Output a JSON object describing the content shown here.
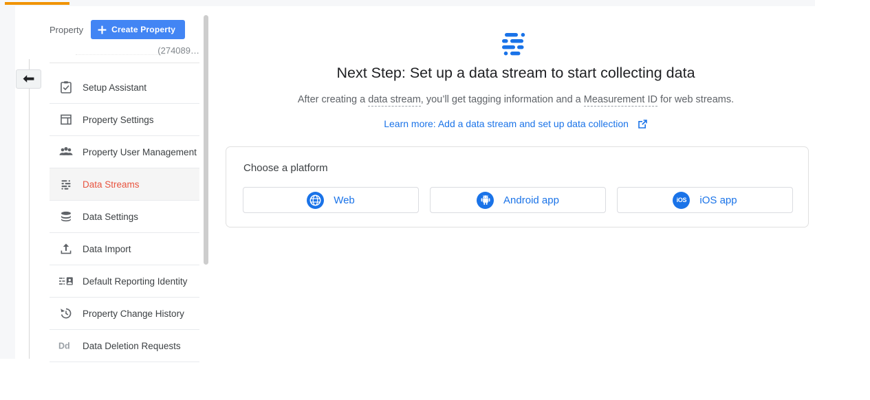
{
  "top_bar": {
    "progress_color": "#f09300",
    "track_color": "#f6f7f9"
  },
  "back_button": {
    "icon": "arrow-back-icon"
  },
  "sidebar": {
    "property_label": "Property",
    "create_property_label": "Create Property",
    "property_name": "(274089…",
    "items": [
      {
        "label": "Setup Assistant",
        "icon": "clipboard-check-icon",
        "active": false
      },
      {
        "label": "Property Settings",
        "icon": "layout-icon",
        "active": false
      },
      {
        "label": "Property User Management",
        "icon": "people-icon",
        "active": false
      },
      {
        "label": "Data Streams",
        "icon": "data-streams-icon",
        "active": true
      },
      {
        "label": "Data Settings",
        "icon": "database-icon",
        "active": false
      },
      {
        "label": "Data Import",
        "icon": "upload-icon",
        "active": false
      },
      {
        "label": "Default Reporting Identity",
        "icon": "reporting-identity-icon",
        "active": false
      },
      {
        "label": "Property Change History",
        "icon": "history-icon",
        "active": false
      },
      {
        "label": "Data Deletion Requests",
        "icon": "dd-icon",
        "active": false
      }
    ],
    "active_item_color": "#e8543f"
  },
  "main": {
    "hero_icon": "data-streams-icon",
    "title": "Next Step: Set up a data stream to start collecting data",
    "subtitle": {
      "part1": "After creating a ",
      "term1": "data stream",
      "part2": ", you’ll get tagging information and a ",
      "term2": "Measurement ID",
      "part3": " for web streams."
    },
    "learn_more_label": "Learn more: Add a data stream and set up data collection",
    "learn_more_icon": "open-in-new-icon",
    "link_color": "#1a73e8"
  },
  "platform_card": {
    "title": "Choose a platform",
    "options": [
      {
        "label": "Web",
        "icon": "globe-icon"
      },
      {
        "label": "Android app",
        "icon": "android-icon"
      },
      {
        "label": "iOS app",
        "icon": "ios-icon"
      }
    ]
  }
}
